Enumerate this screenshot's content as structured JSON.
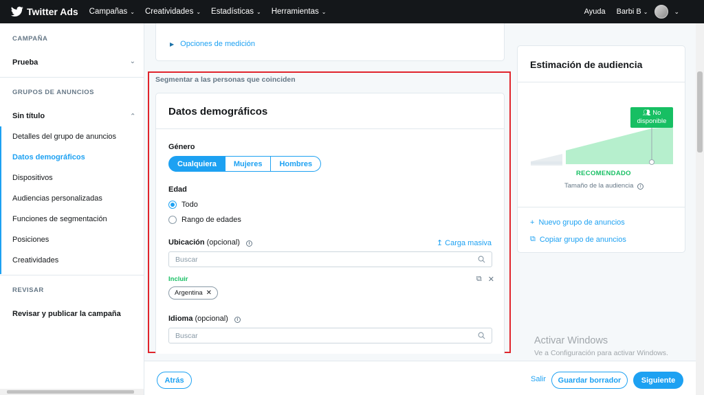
{
  "topnav": {
    "brand": "Twitter Ads",
    "menus": [
      "Campañas",
      "Creatividades",
      "Estadísticas",
      "Herramientas"
    ],
    "help": "Ayuda",
    "user": "Barbi B"
  },
  "sidebar": {
    "campaign_heading": "CAMPAÑA",
    "campaign_name": "Prueba",
    "adgroups_heading": "GRUPOS DE ANUNCIOS",
    "adgroup_name": "Sin título",
    "items": [
      "Detalles del grupo de anuncios",
      "Datos demográficos",
      "Dispositivos",
      "Audiencias personalizadas",
      "Funciones de segmentación",
      "Posiciones",
      "Creatividades"
    ],
    "review_heading": "REVISAR",
    "review_item": "Revisar y publicar la campaña"
  },
  "main": {
    "measurement_options": "Opciones de medición",
    "segment_label": "Segmentar a las personas que coinciden",
    "demographics": {
      "title": "Datos demográficos",
      "gender_label": "Género",
      "gender_options": [
        "Cualquiera",
        "Mujeres",
        "Hombres"
      ],
      "gender_selected": "Cualquiera",
      "age_label": "Edad",
      "age_options": [
        "Todo",
        "Rango de edades"
      ],
      "age_selected": "Todo",
      "location_label": "Ubicación",
      "optional": "(opcional)",
      "bulk_upload": "Carga masiva",
      "location_placeholder": "Buscar",
      "include_label": "Incluir",
      "included_locations": [
        "Argentina"
      ],
      "language_label": "Idioma",
      "language_placeholder": "Buscar"
    }
  },
  "audience": {
    "title": "Estimación de audiencia",
    "status": "No disponible",
    "recommended": "RECOMENDADO",
    "size_label": "Tamaño de la audiencia",
    "new_adgroup": "Nuevo grupo de anuncios",
    "copy_adgroup": "Copiar grupo de anuncios"
  },
  "watermark": {
    "title": "Activar Windows",
    "subtitle": "Ve a Configuración para activar Windows."
  },
  "footer": {
    "back": "Atrás",
    "exit": "Salir",
    "save_draft": "Guardar borrador",
    "next": "Siguiente"
  },
  "colors": {
    "accent": "#1da1f2",
    "green": "#17bf63",
    "highlight_border": "#e0242b",
    "nav_bg": "#14171a"
  }
}
